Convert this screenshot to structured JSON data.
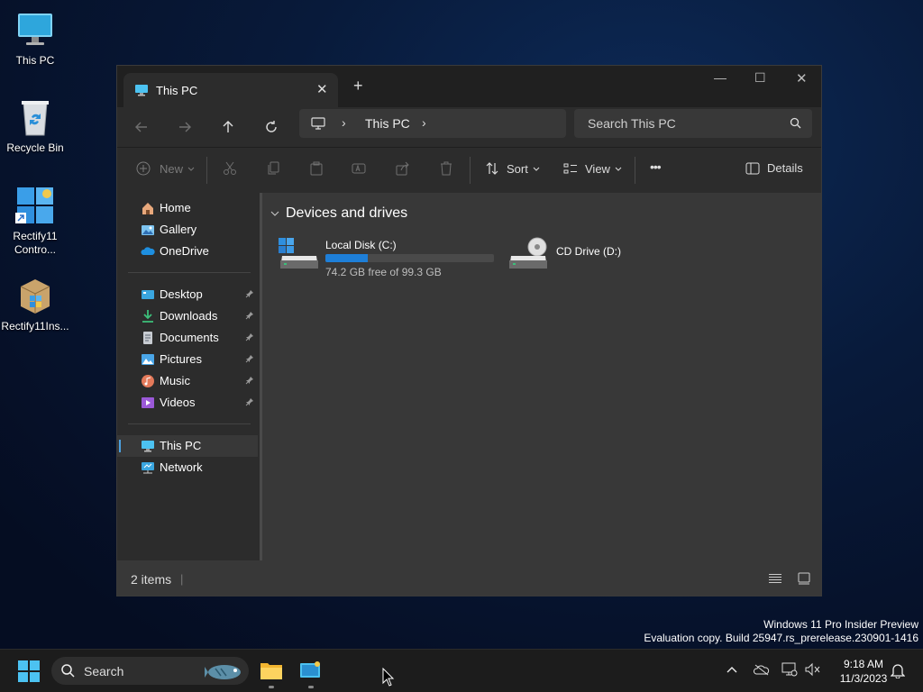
{
  "desktop": {
    "icons": [
      {
        "label": "This PC",
        "icon": "monitor-icon"
      },
      {
        "label": "Recycle Bin",
        "icon": "recycle-bin-icon"
      },
      {
        "label": "Rectify11\nContro...",
        "icon": "control-panel-icon"
      },
      {
        "label": "Rectify11Ins...",
        "icon": "installer-package-icon"
      }
    ]
  },
  "window": {
    "tab_title": "This PC",
    "tab_close": "✕",
    "new_tab": "+",
    "controls": {
      "minimize": "—",
      "maximize": "☐",
      "close": "✕"
    },
    "address": {
      "crumb": "This PC",
      "sep": "›"
    },
    "search_placeholder": "Search This PC",
    "toolbar": {
      "new_label": "New",
      "sort_label": "Sort",
      "view_label": "View",
      "more_label": "•••",
      "details_label": "Details"
    },
    "sidebar": {
      "top": [
        {
          "label": "Home",
          "icon": "home-icon"
        },
        {
          "label": "Gallery",
          "icon": "gallery-icon"
        },
        {
          "label": "OneDrive",
          "icon": "onedrive-icon"
        }
      ],
      "quick": [
        {
          "label": "Desktop",
          "icon": "desktop-folder-icon"
        },
        {
          "label": "Downloads",
          "icon": "downloads-icon"
        },
        {
          "label": "Documents",
          "icon": "documents-icon"
        },
        {
          "label": "Pictures",
          "icon": "pictures-icon"
        },
        {
          "label": "Music",
          "icon": "music-icon"
        },
        {
          "label": "Videos",
          "icon": "videos-icon"
        }
      ],
      "bottom": [
        {
          "label": "This PC",
          "icon": "monitor-icon",
          "selected": true
        },
        {
          "label": "Network",
          "icon": "network-icon"
        }
      ]
    },
    "section_title": "Devices and drives",
    "drives": [
      {
        "name": "Local Disk (C:)",
        "free_text": "74.2 GB free of 99.3 GB",
        "used_fraction": 0.253,
        "icon": "windows-drive-icon"
      },
      {
        "name": "CD Drive (D:)",
        "icon": "cd-drive-icon"
      }
    ],
    "status": {
      "items": "2 items",
      "cursor": "|"
    }
  },
  "watermark": {
    "line1": "Windows 11 Pro Insider Preview",
    "line2": "Evaluation copy. Build 25947.rs_prerelease.230901-1416"
  },
  "taskbar": {
    "search_placeholder": "Search",
    "time": "9:18 AM",
    "date": "11/3/2023"
  },
  "colors": {
    "accent": "#1e7fd8",
    "window_bg": "#202020",
    "panel_bg": "#2c2c2c",
    "content_bg": "#383838"
  }
}
